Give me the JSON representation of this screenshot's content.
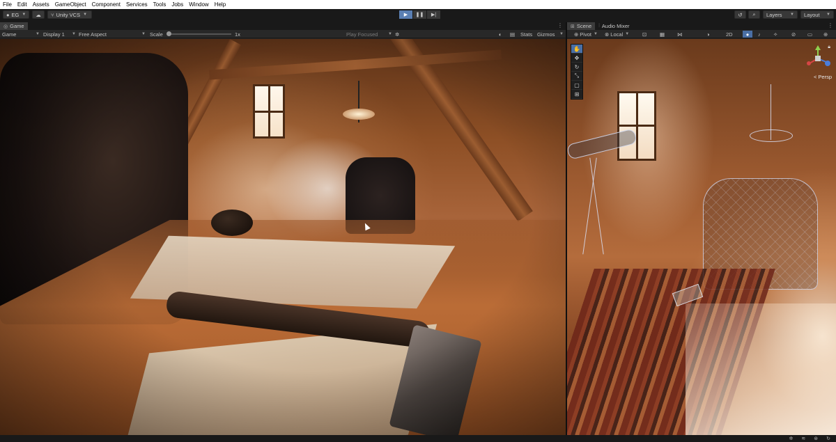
{
  "menu": [
    "File",
    "Edit",
    "Assets",
    "GameObject",
    "Component",
    "Services",
    "Tools",
    "Jobs",
    "Window",
    "Help"
  ],
  "toolbar": {
    "account": "EG",
    "vcs": "Unity VCS",
    "layers": "Layers",
    "layout": "Layout"
  },
  "game_panel": {
    "tab": "Game",
    "mode": "Game",
    "display": "Display 1",
    "aspect": "Free Aspect",
    "scale_label": "Scale",
    "scale_value": "1x",
    "play_focused": "Play Focused",
    "stats": "Stats",
    "gizmos": "Gizmos"
  },
  "scene_panel": {
    "tabs": [
      "Scene",
      "Audio Mixer"
    ],
    "pivot": "Pivot",
    "local": "Local",
    "mode_2d": "2D",
    "persp": "< Persp"
  },
  "colors": {
    "accent": "#5a7fb3",
    "menubar": "#ffffff",
    "panel": "#232323"
  }
}
